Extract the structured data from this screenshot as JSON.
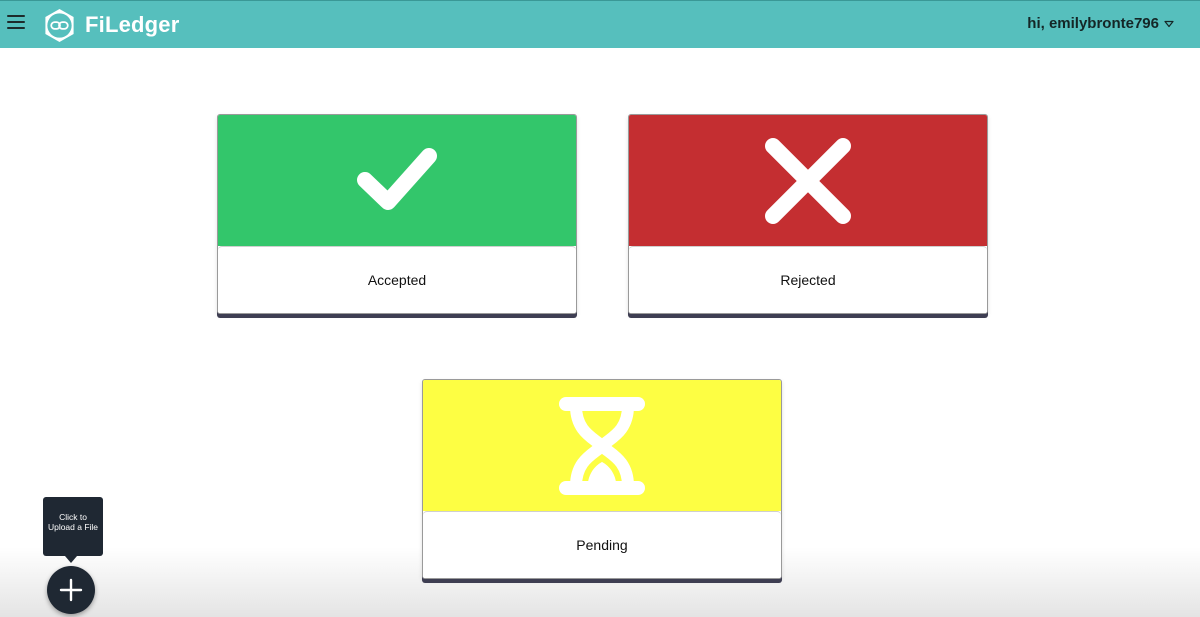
{
  "header": {
    "brand": "FiLedger",
    "greeting": "hi, emilybronte796",
    "menu_icon": "hamburger-menu-icon",
    "logo_icon": "link-logo-icon",
    "user_caret_icon": "caret-down-icon"
  },
  "status_cards": [
    {
      "label": "Accepted",
      "icon": "checkmark-icon",
      "color": "#33c66b"
    },
    {
      "label": "Rejected",
      "icon": "x-icon",
      "color": "#c42e31"
    },
    {
      "label": "Pending",
      "icon": "hourglass-icon",
      "color": "#fdfe43"
    }
  ],
  "upload": {
    "tooltip": "Click to Upload a File",
    "icon": "plus-icon"
  },
  "colors": {
    "header": "#56bfbd",
    "dark": "#1f2833"
  }
}
